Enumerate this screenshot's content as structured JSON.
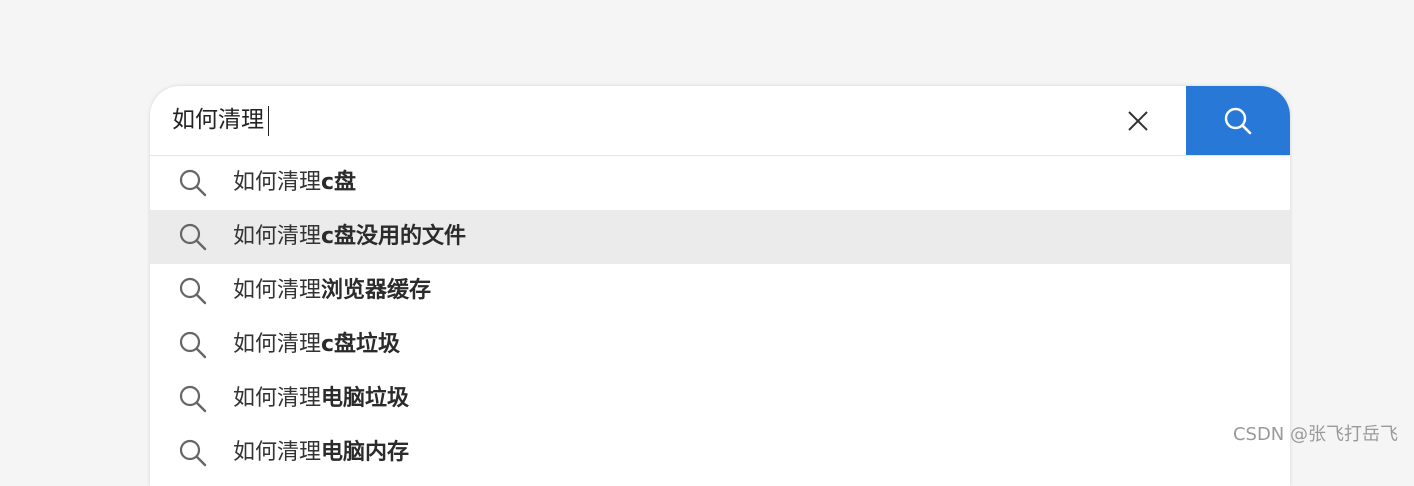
{
  "search": {
    "query": "如何清理",
    "submit_color": "#2878d8",
    "clear_icon": "close-icon",
    "submit_icon": "search-icon"
  },
  "suggestions": [
    {
      "prefix": "如何清理",
      "completion": "c盘",
      "highlighted": false
    },
    {
      "prefix": "如何清理",
      "completion": "c盘没用的文件",
      "highlighted": true
    },
    {
      "prefix": "如何清理",
      "completion": "浏览器缓存",
      "highlighted": false
    },
    {
      "prefix": "如何清理",
      "completion": "c盘垃圾",
      "highlighted": false
    },
    {
      "prefix": "如何清理",
      "completion": "电脑垃圾",
      "highlighted": false
    },
    {
      "prefix": "如何清理",
      "completion": "电脑内存",
      "highlighted": false
    }
  ],
  "watermark": "CSDN @张飞打岳飞"
}
